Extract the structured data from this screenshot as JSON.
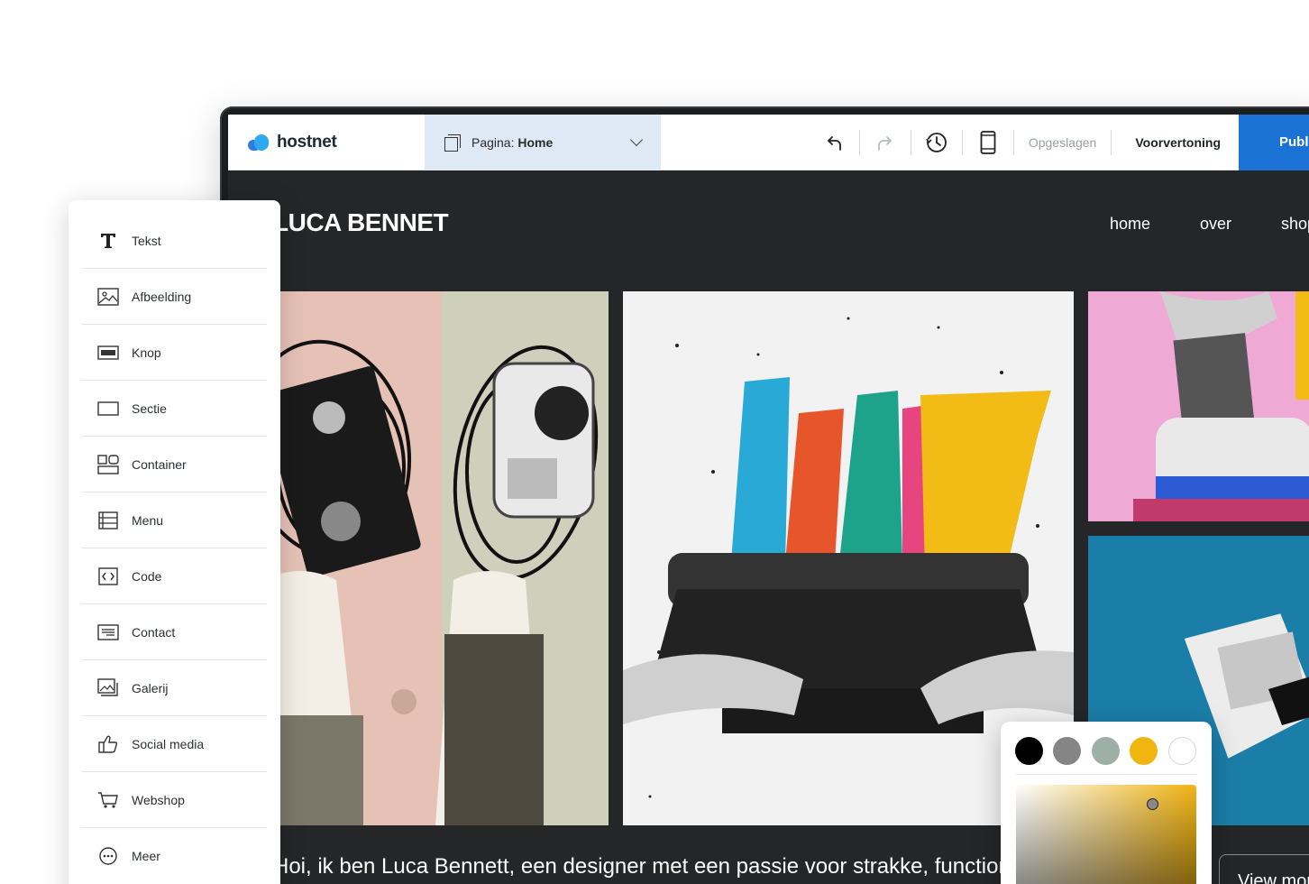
{
  "toolbar": {
    "brand": "hostnet",
    "page_label": "Pagina:",
    "page_value": "Home",
    "saved_label": "Opgeslagen",
    "preview_label": "Voorvertoning",
    "publish_label": "Publiceren",
    "icons": [
      "undo-icon",
      "redo-icon",
      "history-icon",
      "mobile-icon"
    ]
  },
  "site": {
    "logo": "LUCA BENNET",
    "nav": [
      "home",
      "over",
      "shop"
    ],
    "intro": "Hoi, ik ben Luca Bennett, een designer met een passie voor strakke, functionele",
    "view_button": "View more"
  },
  "panel": {
    "items": [
      {
        "label": "Tekst",
        "icon": "text-icon"
      },
      {
        "label": "Afbeelding",
        "icon": "image-icon"
      },
      {
        "label": "Knop",
        "icon": "button-icon"
      },
      {
        "label": "Sectie",
        "icon": "section-icon"
      },
      {
        "label": "Container",
        "icon": "container-icon"
      },
      {
        "label": "Menu",
        "icon": "menu-icon"
      },
      {
        "label": "Code",
        "icon": "code-icon"
      },
      {
        "label": "Contact",
        "icon": "contact-icon"
      },
      {
        "label": "Galerij",
        "icon": "gallery-icon"
      },
      {
        "label": "Social media",
        "icon": "thumbs-up-icon"
      },
      {
        "label": "Webshop",
        "icon": "cart-icon"
      },
      {
        "label": "Meer",
        "icon": "more-icon"
      }
    ]
  },
  "picker": {
    "swatches": [
      "#000000",
      "#858585",
      "#9cb0a6",
      "#f0b50f",
      "#ffffff"
    ]
  },
  "colors": {
    "accent": "#1a73d4",
    "page_select_bg": "#dfe9f5",
    "site_bg": "#242627"
  }
}
